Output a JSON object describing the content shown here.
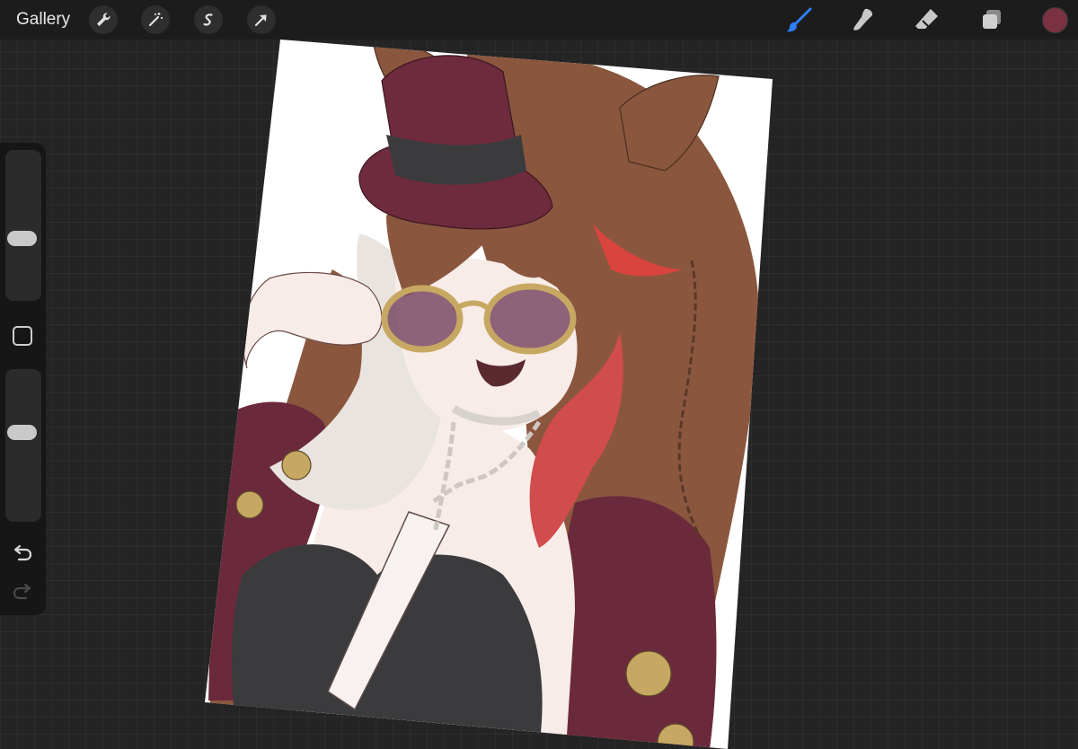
{
  "app": {
    "gallery_label": "Gallery"
  },
  "toolbar_left": [
    {
      "name": "actions-wrench-icon"
    },
    {
      "name": "adjustments-wand-icon"
    },
    {
      "name": "selection-s-icon"
    },
    {
      "name": "transform-arrow-icon"
    }
  ],
  "toolbar_right": [
    {
      "name": "brush-icon",
      "active": true
    },
    {
      "name": "smudge-icon",
      "active": false
    },
    {
      "name": "eraser-icon",
      "active": false
    },
    {
      "name": "layers-icon",
      "active": false
    }
  ],
  "colors": {
    "active_color": "#7a3142",
    "accent_blue": "#2f7ef6",
    "background": "#242424",
    "artwork_hat": "#6e2b3d",
    "artwork_hair": "#8a573e",
    "artwork_jacket": "#6b2a3b",
    "artwork_dress": "#3b3b3d",
    "artwork_gold": "#c7a862"
  },
  "sidebar": {
    "brush_size_level": 0.4,
    "opacity_level": 0.6,
    "undo_icon": "undo-arrow-icon",
    "redo_icon": "redo-arrow-icon"
  }
}
